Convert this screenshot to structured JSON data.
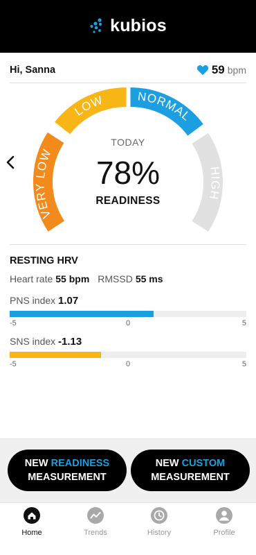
{
  "app": {
    "brand": "kubios"
  },
  "header": {
    "greeting": "Hi, Sanna",
    "heart_rate": "59",
    "heart_rate_unit": "bpm"
  },
  "gauge": {
    "today_label": "TODAY",
    "percent": "78%",
    "readiness_label": "READINESS",
    "segments": [
      "VERY LOW",
      "LOW",
      "NORMAL",
      "HIGH"
    ],
    "colors": {
      "very_low": "#f28a1c",
      "low": "#f7b516",
      "normal": "#1b9fe0",
      "high": "#e1e1e1"
    }
  },
  "resting_hrv": {
    "title": "RESTING HRV",
    "heart_rate_label": "Heart rate",
    "heart_rate_value": "55 bpm",
    "rmssd_label": "RMSSD",
    "rmssd_value": "55 ms",
    "pns": {
      "label": "PNS index",
      "value": "1.07",
      "value_num": 1.07,
      "color": "#1b9fe0"
    },
    "sns": {
      "label": "SNS index",
      "value": "-1.13",
      "value_num": -1.13,
      "color": "#f7b516"
    },
    "scale": {
      "min": "-5",
      "mid": "0",
      "max": "5",
      "min_num": -5,
      "max_num": 5
    }
  },
  "actions": {
    "readiness": {
      "line1a": "NEW ",
      "line1b": "READINESS",
      "line2": "MEASUREMENT"
    },
    "custom": {
      "line1a": "NEW ",
      "line1b": "CUSTOM",
      "line2": "MEASUREMENT"
    }
  },
  "tabs": [
    {
      "label": "Home",
      "icon": "home-icon",
      "active": true
    },
    {
      "label": "Trends",
      "icon": "trends-icon",
      "active": false
    },
    {
      "label": "History",
      "icon": "history-icon",
      "active": false
    },
    {
      "label": "Profile",
      "icon": "profile-icon",
      "active": false
    }
  ]
}
